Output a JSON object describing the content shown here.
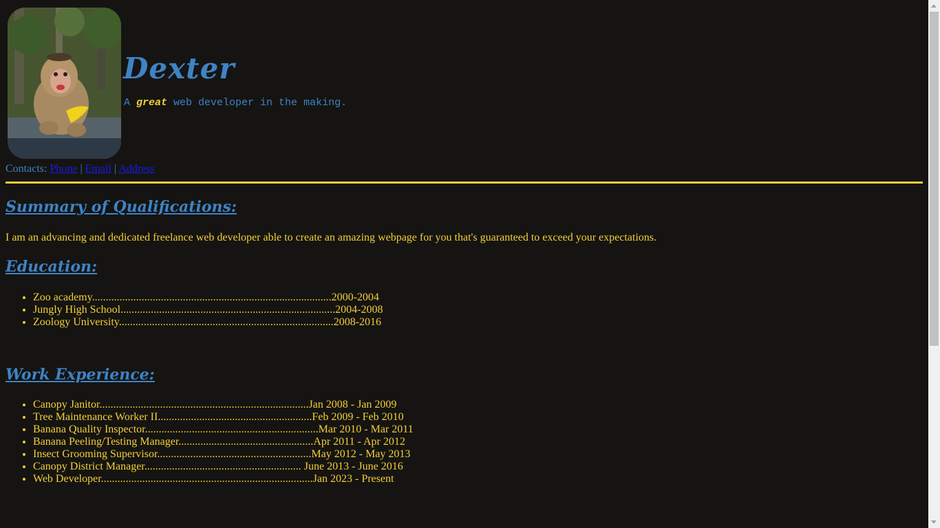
{
  "header": {
    "name": "Dexter",
    "tagline_pre": "A ",
    "tagline_em": "great",
    "tagline_post": " web developer in the making."
  },
  "contacts": {
    "label": "Contacts:",
    "phone": "Phone",
    "email": "Email",
    "address": "Address",
    "separator": "|"
  },
  "summary": {
    "heading": "Summary of Qualifications:",
    "text": "I am an advancing and dedicated freelance web developer able to create an amazing webpage for you that's guaranteed to exceed your expectations."
  },
  "education": {
    "heading": "Education:",
    "items": [
      "Zoo academy.......................................................................................2000-2004",
      "Jungly High School..............................................................................2004-2008",
      "Zoology University..............................................................................2008-2016"
    ]
  },
  "work": {
    "heading": "Work Experience:",
    "items": [
      "Canopy Janitor............................................................................Jan 2008 - Jan 2009",
      "Tree Maintenance Worker II........................................................Feb 2009 - Feb 2010",
      "Banana Quality Inspector...............................................................Mar 2010 - Mar 2011",
      "Banana Peeling/Testing Manager.................................................Apr 2011 - Apr 2012",
      "Insect Grooming Supervisor........................................................May 2012 - May 2013",
      "Canopy District Manager......................................................... June 2013 - June 2016",
      "Web Developer.............................................................................Jan 2023 - Present"
    ]
  },
  "colors": {
    "background": "#151412",
    "text": "#f4cf38",
    "accent": "#3e83c5",
    "link": "#1a1ae6"
  }
}
